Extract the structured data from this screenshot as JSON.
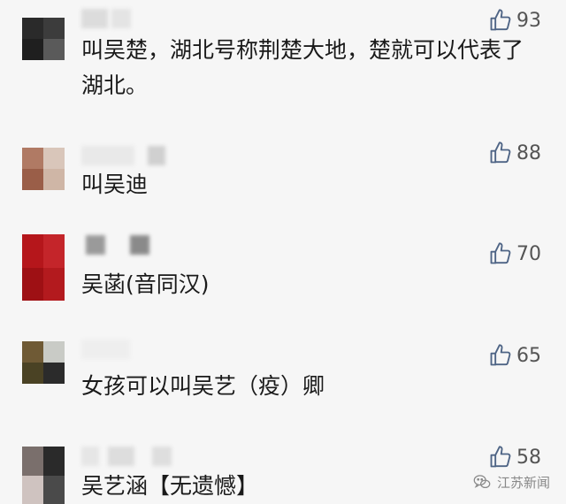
{
  "comments": [
    {
      "text": "叫吴楚，湖北号称荆楚大地，楚就可以代表了湖北。",
      "likes": "93"
    },
    {
      "text": "叫吴迪",
      "likes": "88"
    },
    {
      "text": "吴菡(音同汉)",
      "likes": "70"
    },
    {
      "text": "女孩可以叫吴艺（疫）卿",
      "likes": "65"
    },
    {
      "text": "吴艺涵【无遗憾】",
      "likes": "58"
    }
  ],
  "icons": {
    "like": "thumbs-up-icon",
    "watermark": "wechat-icon"
  },
  "watermark": {
    "text": "江苏新闻"
  },
  "colors": {
    "background": "#f6f6f6",
    "like_icon": "#4e6485",
    "text": "#1a1a1a"
  }
}
